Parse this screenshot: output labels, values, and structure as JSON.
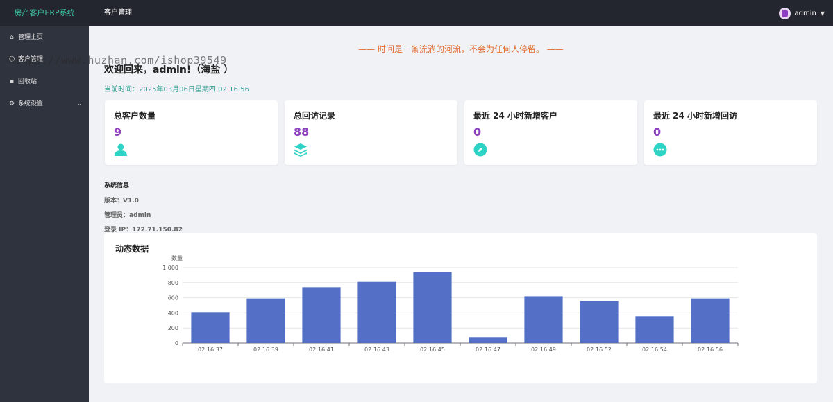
{
  "header": {
    "brand": "房产客户ERP系统",
    "nav_label": "客户管理",
    "username": "admin",
    "caret_icon": "chevron-down-icon"
  },
  "sidebar": {
    "items": [
      {
        "label": "管理主页",
        "icon": "home-icon"
      },
      {
        "label": "客户管理",
        "icon": "user-icon"
      },
      {
        "label": "回收站",
        "icon": "trash-icon"
      },
      {
        "label": "系统设置",
        "icon": "gear-icon"
      }
    ]
  },
  "watermark": "https://www.huzhan.com/ishop39549",
  "main": {
    "motto": "—— 时间是一条流淌的河流，不会为任何人停留。 ——",
    "welcome": "欢迎回来，admin!（海盐 ）",
    "current_time": "当前时间：2025年03月06日星期四 02:16:56",
    "cards": [
      {
        "title": "总客户数量",
        "value": "9",
        "icon": "person-icon"
      },
      {
        "title": "总回访记录",
        "value": "88",
        "icon": "layers-icon"
      },
      {
        "title": "最近 24 小时新增客户",
        "value": "0",
        "icon": "compass-icon"
      },
      {
        "title": "最近 24 小时新增回访",
        "value": "0",
        "icon": "chat-bubble-icon"
      }
    ],
    "system_info": {
      "title": "系统信息",
      "version": "版本：V1.0",
      "admin": "管理员：admin",
      "ip": "登录 IP：172.71.150.82"
    }
  },
  "chart_panel": {
    "title": "动态数据"
  },
  "colors": {
    "accent": "#8e3fbf",
    "icon_teal": "#2ed3c6",
    "bar": "#5470c6",
    "motto": "#e16a2f",
    "time": "#2a9d8f"
  },
  "chart_data": {
    "type": "bar",
    "ylabel": "数量",
    "ylim": [
      0,
      1000
    ],
    "yticks": [
      "0",
      "200",
      "400",
      "600",
      "800",
      "1,000"
    ],
    "categories": [
      "02:16:37",
      "02:16:39",
      "02:16:41",
      "02:16:43",
      "02:16:45",
      "02:16:47",
      "02:16:49",
      "02:16:52",
      "02:16:54",
      "02:16:56"
    ],
    "values": [
      410,
      590,
      740,
      810,
      940,
      80,
      620,
      560,
      355,
      590
    ],
    "grid": true
  }
}
